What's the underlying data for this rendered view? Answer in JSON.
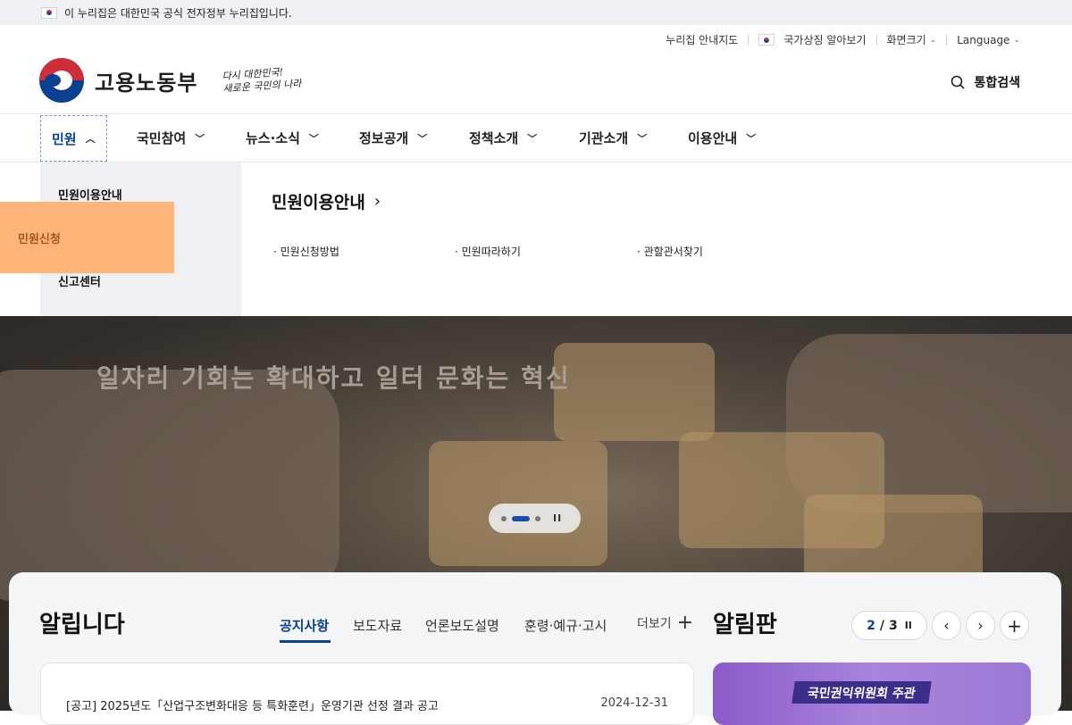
{
  "gov_banner": {
    "text": "이 누리집은 대한민국 공식 전자정부 누리집입니다."
  },
  "utility": {
    "sitemap": "누리집 안내지도",
    "national_symbols": "국가상징 알아보기",
    "font_size": "화면크기",
    "language": "Language"
  },
  "header": {
    "ministry": "고용노동부",
    "slogan_line1": "다시 대한민국!",
    "slogan_line2": "새로운 국민의 나라",
    "search_label": "통합검색"
  },
  "gnb": {
    "items": [
      {
        "label": "민원",
        "active": true
      },
      {
        "label": "국민참여"
      },
      {
        "label": "뉴스·소식"
      },
      {
        "label": "정보공개"
      },
      {
        "label": "정책소개"
      },
      {
        "label": "기관소개"
      },
      {
        "label": "이용안내"
      }
    ]
  },
  "submenu": {
    "items": [
      "민원이용안내",
      "민원신청",
      "신고센터"
    ],
    "section_title": "민원이용안내",
    "links": [
      "· 민원신청방법",
      "· 민원따라하기",
      "· 관할관서찾기"
    ]
  },
  "hero": {
    "title": "일자리 기회는 확대하고 일터 문화는 혁신",
    "pause_label": "II"
  },
  "notices": {
    "title": "알립니다",
    "tabs": [
      "공지사항",
      "보도자료",
      "언론보도설명",
      "훈령·예규·고시"
    ],
    "more": "더보기",
    "rows": [
      {
        "title": "[공고] 2025년도「산업구조변화대응 등 특화훈련」운영기관 선정 결과 공고",
        "date": "2024-12-31"
      }
    ]
  },
  "board": {
    "title": "알림판",
    "page_current": "2",
    "page_sep": "/",
    "page_total": "3",
    "pause": "II",
    "promo_label": "국민권익위원회 주관"
  },
  "colors": {
    "brand_blue": "#0b3f91",
    "highlight": "#ffb57a",
    "submenu_bg": "#eef0f4"
  }
}
